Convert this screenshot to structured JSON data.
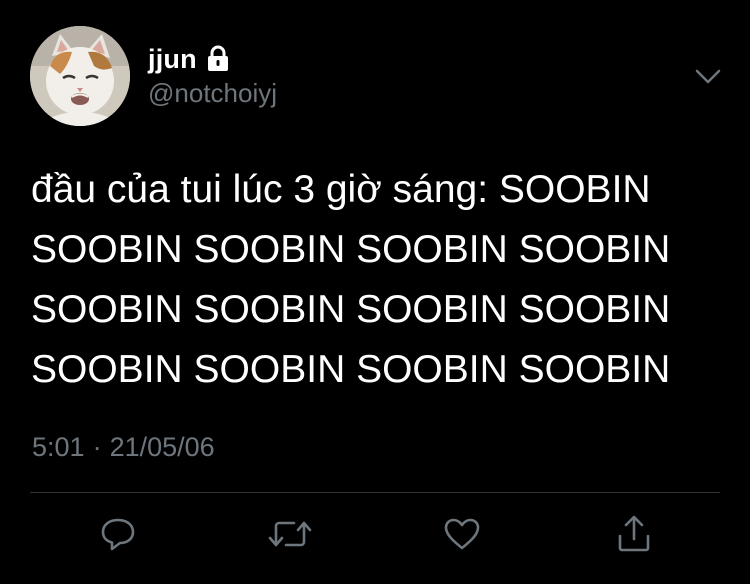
{
  "user": {
    "display_name": "jjun",
    "handle": "@notchoiyj",
    "protected_icon": "lock-icon",
    "avatar_icon": "cat-avatar"
  },
  "tweet": {
    "text": "đầu của tui lúc 3 giờ sáng: SOOBIN\nSOOBIN SOOBIN SOOBIN SOOBIN\nSOOBIN SOOBIN SOOBIN SOOBIN\nSOOBIN SOOBIN SOOBIN SOOBIN",
    "time": "5:01",
    "separator": "·",
    "date": "21/05/06"
  },
  "actions": [
    {
      "name": "reply",
      "icon": "reply-icon"
    },
    {
      "name": "retweet",
      "icon": "retweet-icon"
    },
    {
      "name": "like",
      "icon": "heart-icon"
    },
    {
      "name": "share",
      "icon": "share-icon"
    }
  ],
  "menu_icon": "chevron-down-icon",
  "colors": {
    "background": "#000000",
    "text": "#ffffff",
    "secondary": "#6e767d",
    "divider": "#2f3336"
  }
}
